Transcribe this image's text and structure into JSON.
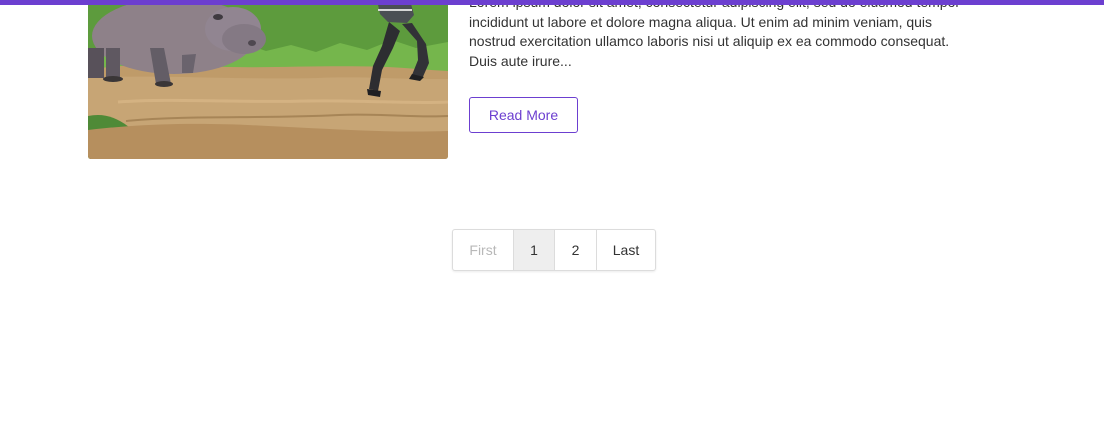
{
  "theme": {
    "accent": "#6c3fd0",
    "text": "#333333",
    "muted": "#b8b8b8",
    "active_page_bg": "#eeeeee"
  },
  "post": {
    "excerpt": "Lorem ipsum dolor sit amet, consectetur adipiscing elit, sed do eiusmod tempor incididunt ut labore et dolore magna aliqua. Ut enim ad minim veniam, quis nostrud exercitation ullamco laboris nisi ut aliquip ex ea commodo consequat. Duis aute irure...",
    "read_more_label": "Read More"
  },
  "pagination": {
    "first_label": "First",
    "pages": [
      "1",
      "2"
    ],
    "current_page": "1",
    "last_label": "Last"
  }
}
